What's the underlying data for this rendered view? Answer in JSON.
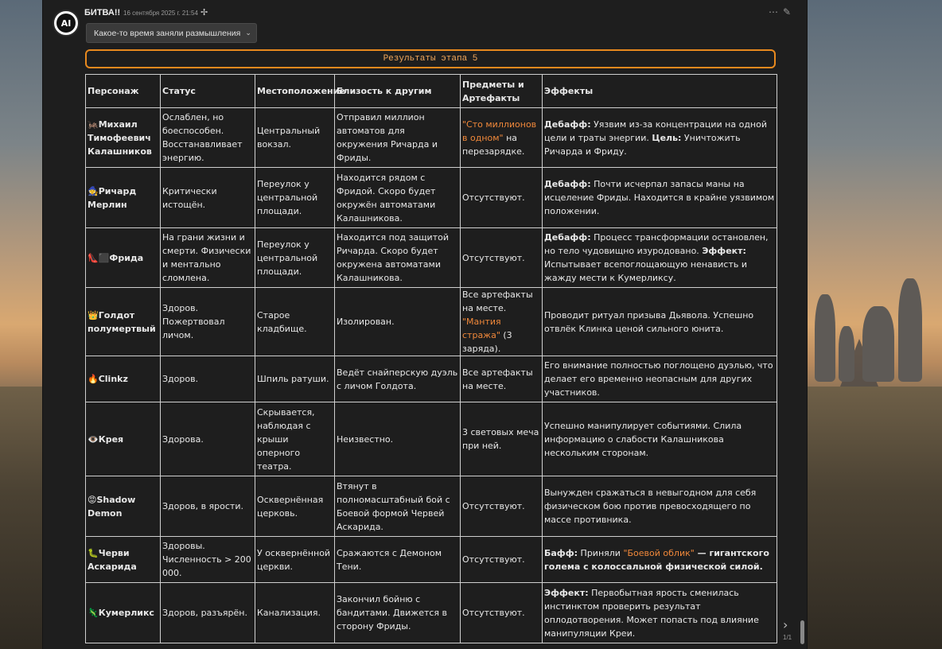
{
  "message": {
    "author": "БИТВА!!",
    "timestamp": "16 сентября 2025 г. 21:54",
    "avatar_text": "AI",
    "thinking_label": "Какое-то время заняли размышления"
  },
  "banner": "Результаты этапа 5",
  "table": {
    "headers": [
      "Персонаж",
      "Статус",
      "Местоположение",
      "Близость к другим",
      "Предметы и Артефакты",
      "Эффекты"
    ],
    "rows": [
      {
        "icon": "🦗",
        "name": "Михаил Тимофеевич Калашников",
        "status": "Ослаблен, но боеспособен. Восстанавливает энергию.",
        "location": "Центральный вокзал.",
        "proximity": "Отправил миллион автоматов для окружения Ричарда и Фриды.",
        "items_hl": "\"Сто миллионов в одном\"",
        "items_rest": " на перезарядке.",
        "eff_label1": "Дебафф:",
        "eff_text1": " Уязвим из-за концентрации на одной цели и траты энергии. ",
        "eff_label2": "Цель:",
        "eff_text2": " Уничтожить Ричарда и Фриду."
      },
      {
        "icon": "🧙",
        "name": "Ричард Мерлин",
        "status": "Критически истощён.",
        "location": "Переулок у центральной площади.",
        "proximity": "Находится рядом с Фридой. Скоро будет окружён автоматами Калашникова.",
        "items": "Отсутствуют.",
        "eff_label1": "Дебафф:",
        "eff_text1": " Почти исчерпал запасы маны на исцеление Фриды. Находится в крайне уязвимом положении."
      },
      {
        "icon": "👠⬛",
        "name": "Фрида",
        "status": "На грани жизни и смерти. Физически и ментально сломлена.",
        "location": "Переулок у центральной площади.",
        "proximity": "Находится под защитой Ричарда. Скоро будет окружена автоматами Калашникова.",
        "items": "Отсутствуют.",
        "eff_label1": "Дебафф:",
        "eff_text1": " Процесс трансформации остановлен, но тело чудовищно изуродовано. ",
        "eff_label2": "Эффект:",
        "eff_text2": " Испытывает всепоглощающую ненависть и жажду мести к Кумерликсу."
      },
      {
        "icon": "👑",
        "name": "Голдот полумертвый",
        "status": "Здоров. Пожертвовал личом.",
        "location": "Старое кладбище.",
        "proximity": "Изолирован.",
        "items_pre": "Все артефакты на месте. ",
        "items_hl": "\"Мантия стража\"",
        "items_rest": " (3 заряда).",
        "effects": "Проводит ритуал призыва Дьявола. Успешно отвлёк Клинка ценой сильного юнита."
      },
      {
        "icon": "🔥",
        "name": "Clinkz",
        "status": "Здоров.",
        "location": "Шпиль ратуши.",
        "proximity": "Ведёт снайперскую дуэль с личом Голдота.",
        "items": "Все артефакты на месте.",
        "effects": "Его внимание полностью поглощено дуэлью, что делает его временно неопасным для других участников."
      },
      {
        "icon": "👁️",
        "name": "Крея",
        "status": "Здорова.",
        "location": "Скрывается, наблюдая с крыши оперного театра.",
        "proximity": "Неизвестно.",
        "items": "3 световых меча при ней.",
        "effects": "Успешно манипулирует событиями. Слила информацию о слабости Калашникова нескольким сторонам."
      },
      {
        "icon": "😡",
        "name": "Shadow Demon",
        "status": "Здоров, в ярости.",
        "location": "Осквернённая церковь.",
        "proximity": "Втянут в полномасштабный бой с Боевой формой Червей Аскарида.",
        "items": "Отсутствуют.",
        "effects": "Вынужден сражаться в невыгодном для себя физическом бою против превосходящего по массе противника."
      },
      {
        "icon": "🐛",
        "name": "Черви Аскарида",
        "status": "Здоровы. Численность > 200 000.",
        "location": "У осквернённой церкви.",
        "proximity": "Сражаются с Демоном Тени.",
        "items": "Отсутствуют.",
        "eff_label1": "Бафф:",
        "eff_text1": " Приняли ",
        "eff_hl": "\"Боевой облик\"",
        "eff_text2": " — гигантского голема с колоссальной физической силой."
      },
      {
        "icon": "🦎",
        "name": "Кумерликс",
        "status": "Здоров, разъярён.",
        "location": "Канализация.",
        "proximity": "Закончил бойню с бандитами. Движется в сторону Фриды.",
        "items": "Отсутствуют.",
        "eff_label1": "Эффект:",
        "eff_text1": " Первобытная ярость сменилась инстинктом проверить результат оплодотворения. Может попасть под влияние манипуляции Креи."
      }
    ]
  },
  "pagination": {
    "indicator": "1/1"
  },
  "colors": {
    "accent": "#e8891e",
    "highlight": "#f0883a",
    "panel": "#1e1e1e"
  }
}
